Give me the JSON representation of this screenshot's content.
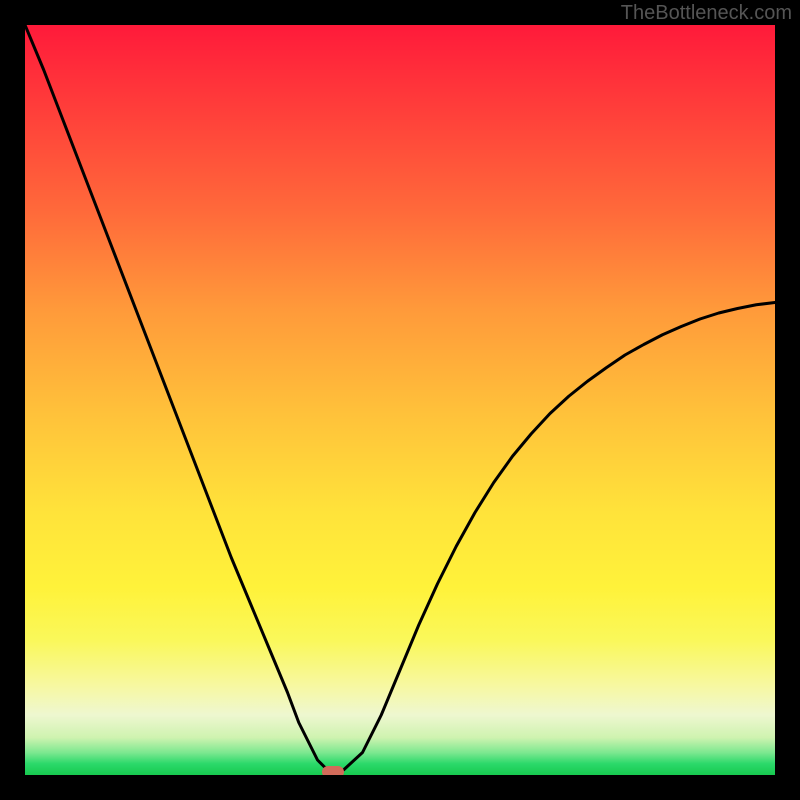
{
  "watermark": "TheBottleneck.com",
  "chart_data": {
    "type": "line",
    "title": "",
    "xlabel": "",
    "ylabel": "",
    "xlim": [
      0,
      100
    ],
    "ylim": [
      0,
      100
    ],
    "x": [
      0,
      2.5,
      5,
      7.5,
      10,
      12.5,
      15,
      17.5,
      20,
      22.5,
      25,
      27.5,
      30,
      32.5,
      35,
      36.5,
      38,
      39,
      40,
      41,
      42.5,
      45,
      47.5,
      50,
      52.5,
      55,
      57.5,
      60,
      62.5,
      65,
      67.5,
      70,
      72.5,
      75,
      77.5,
      80,
      82.5,
      85,
      87.5,
      90,
      92.5,
      95,
      97.5,
      100
    ],
    "values": [
      100,
      94,
      87.5,
      81,
      74.5,
      68,
      61.5,
      55,
      48.5,
      42,
      35.5,
      29,
      23,
      17,
      11,
      7,
      4,
      2,
      1,
      0.5,
      0.7,
      3,
      8,
      14,
      20,
      25.5,
      30.5,
      35,
      39,
      42.5,
      45.5,
      48.2,
      50.5,
      52.5,
      54.3,
      56,
      57.4,
      58.7,
      59.8,
      60.8,
      61.6,
      62.2,
      62.7,
      63
    ],
    "marker": {
      "x": 41,
      "y": 0.4
    },
    "gradient_stops": [
      {
        "pct": 0,
        "color": "#ff1a3a"
      },
      {
        "pct": 50,
        "color": "#ffe33a"
      },
      {
        "pct": 95,
        "color": "#cff3b0"
      },
      {
        "pct": 100,
        "color": "#17c94f"
      }
    ]
  }
}
